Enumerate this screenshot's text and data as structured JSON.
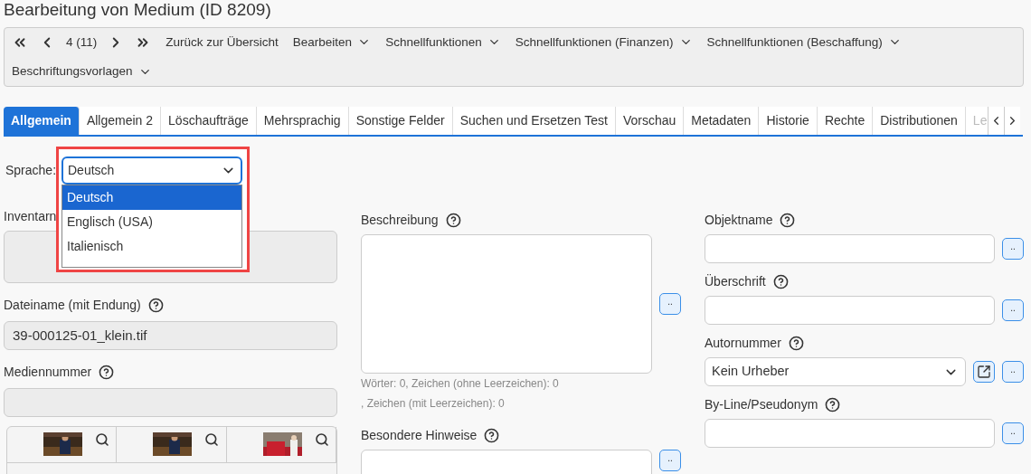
{
  "title": "Bearbeitung von Medium (ID 8209)",
  "toolbar": {
    "position": "4 (11)",
    "items": [
      {
        "label": "Zurück zur Übersicht",
        "kind": "link"
      },
      {
        "label": "Bearbeiten",
        "kind": "menu"
      },
      {
        "label": "Schnellfunktionen",
        "kind": "menu"
      },
      {
        "label": "Schnellfunktionen (Finanzen)",
        "kind": "menu"
      },
      {
        "label": "Schnellfunktionen (Beschaffung)",
        "kind": "menu"
      },
      {
        "label": "Beschriftungsvorlagen",
        "kind": "menu"
      }
    ]
  },
  "tabs": [
    {
      "label": "Allgemein",
      "selected": true
    },
    {
      "label": "Allgemein 2",
      "selected": false
    },
    {
      "label": "Löschaufträge",
      "selected": false
    },
    {
      "label": "Mehrsprachig",
      "selected": false
    },
    {
      "label": "Sonstige Felder",
      "selected": false
    },
    {
      "label": "Suchen und Ersetzen Test",
      "selected": false
    },
    {
      "label": "Vorschau",
      "selected": false
    },
    {
      "label": "Metadaten",
      "selected": false
    },
    {
      "label": "Historie",
      "selected": false
    },
    {
      "label": "Rechte",
      "selected": false
    },
    {
      "label": "Distributionen",
      "selected": false
    },
    {
      "label": "Le",
      "selected": false
    }
  ],
  "language": {
    "label": "Sprache:",
    "value": "Deutsch",
    "options": [
      {
        "label": "Deutsch",
        "selected": true
      },
      {
        "label": "Englisch (USA)",
        "selected": false
      },
      {
        "label": "Italienisch",
        "selected": false
      }
    ]
  },
  "left": {
    "inventory_label": "Inventarn",
    "file_label": "Dateiname (mit Endung)",
    "file_value": "39-000125-01_klein.tif",
    "media_label": "Mediennummer"
  },
  "middle": {
    "description_label": "Beschreibung",
    "counter_1": "Wörter: 0, Zeichen (ohne Leerzeichen): 0",
    "counter_2": ", Zeichen (mit Leerzeichen): 0",
    "notes_label": "Besondere Hinweise",
    "more": ".."
  },
  "right": [
    {
      "label": "Objektname",
      "kind": "text",
      "more": ".."
    },
    {
      "label": "Überschrift",
      "kind": "text",
      "more": ".."
    },
    {
      "label": "Autornummer",
      "kind": "select",
      "value": "Kein Urheber",
      "more": ".."
    },
    {
      "label": "By-Line/Pseudonym",
      "kind": "text",
      "more": ".."
    }
  ]
}
